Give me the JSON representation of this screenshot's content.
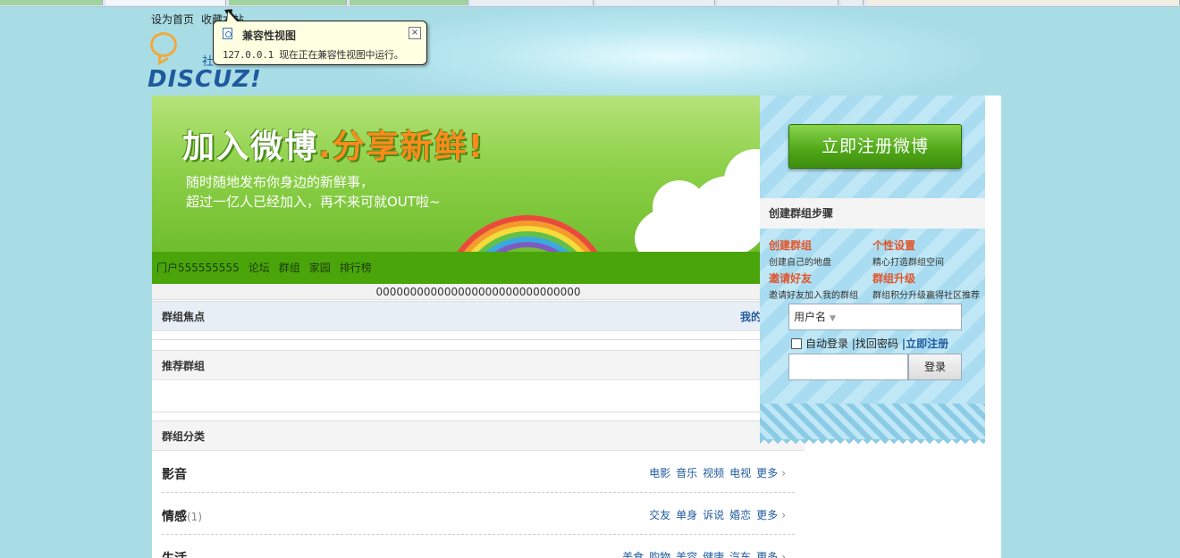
{
  "toplinks": [
    "设为首页",
    "收藏本站"
  ],
  "logo": {
    "text": "DISCUZ!",
    "subtitle": "社"
  },
  "tooltip": {
    "title": "兼容性视图",
    "message": "127.0.0.1 现在正在兼容性视图中运行。",
    "close": "×"
  },
  "banner": {
    "slogan_a": "加入微博",
    "slogan_b": ".分享新鲜!",
    "line1": "随时随地发布你身边的新鲜事，",
    "line2": "超过一亿人已经加入，再不来可就OUT啦~"
  },
  "nav": [
    "门户555555555",
    "论坛",
    "群组",
    "家园",
    "排行榜"
  ],
  "notice": "000000000000000000000000000000",
  "sections": {
    "focus": {
      "title": "群组焦点",
      "right": "我的"
    },
    "recommend": {
      "title": "推荐群组"
    },
    "category": {
      "title": "群组分类"
    }
  },
  "categories": [
    {
      "name": "影音",
      "count": "",
      "links": [
        "电影",
        "音乐",
        "视频",
        "电视"
      ],
      "more": "更多"
    },
    {
      "name": "情感",
      "count": "(1)",
      "links": [
        "交友",
        "单身",
        "诉说",
        "婚恋"
      ],
      "more": "更多"
    },
    {
      "name": "生活",
      "count": "",
      "links": [
        "美食",
        "购物",
        "美容",
        "健康",
        "汽车"
      ],
      "more": "更多"
    }
  ],
  "side": {
    "register_btn": "立即注册微博",
    "steps_title": "创建群组步骤",
    "steps": [
      {
        "title": "创建群组",
        "desc": "创建自己的地盘"
      },
      {
        "title": "个性设置",
        "desc": "精心打造群组空间"
      },
      {
        "title": "邀请好友",
        "desc": "邀请好友加入我的群组"
      },
      {
        "title": "群组升级",
        "desc": "群组积分升级赢得社区推荐"
      }
    ],
    "username_label": "用户名",
    "auto_login": "自动登录",
    "find_pwd": "|找回密码",
    "register_link": "|立即注册",
    "login_btn": "登录"
  }
}
